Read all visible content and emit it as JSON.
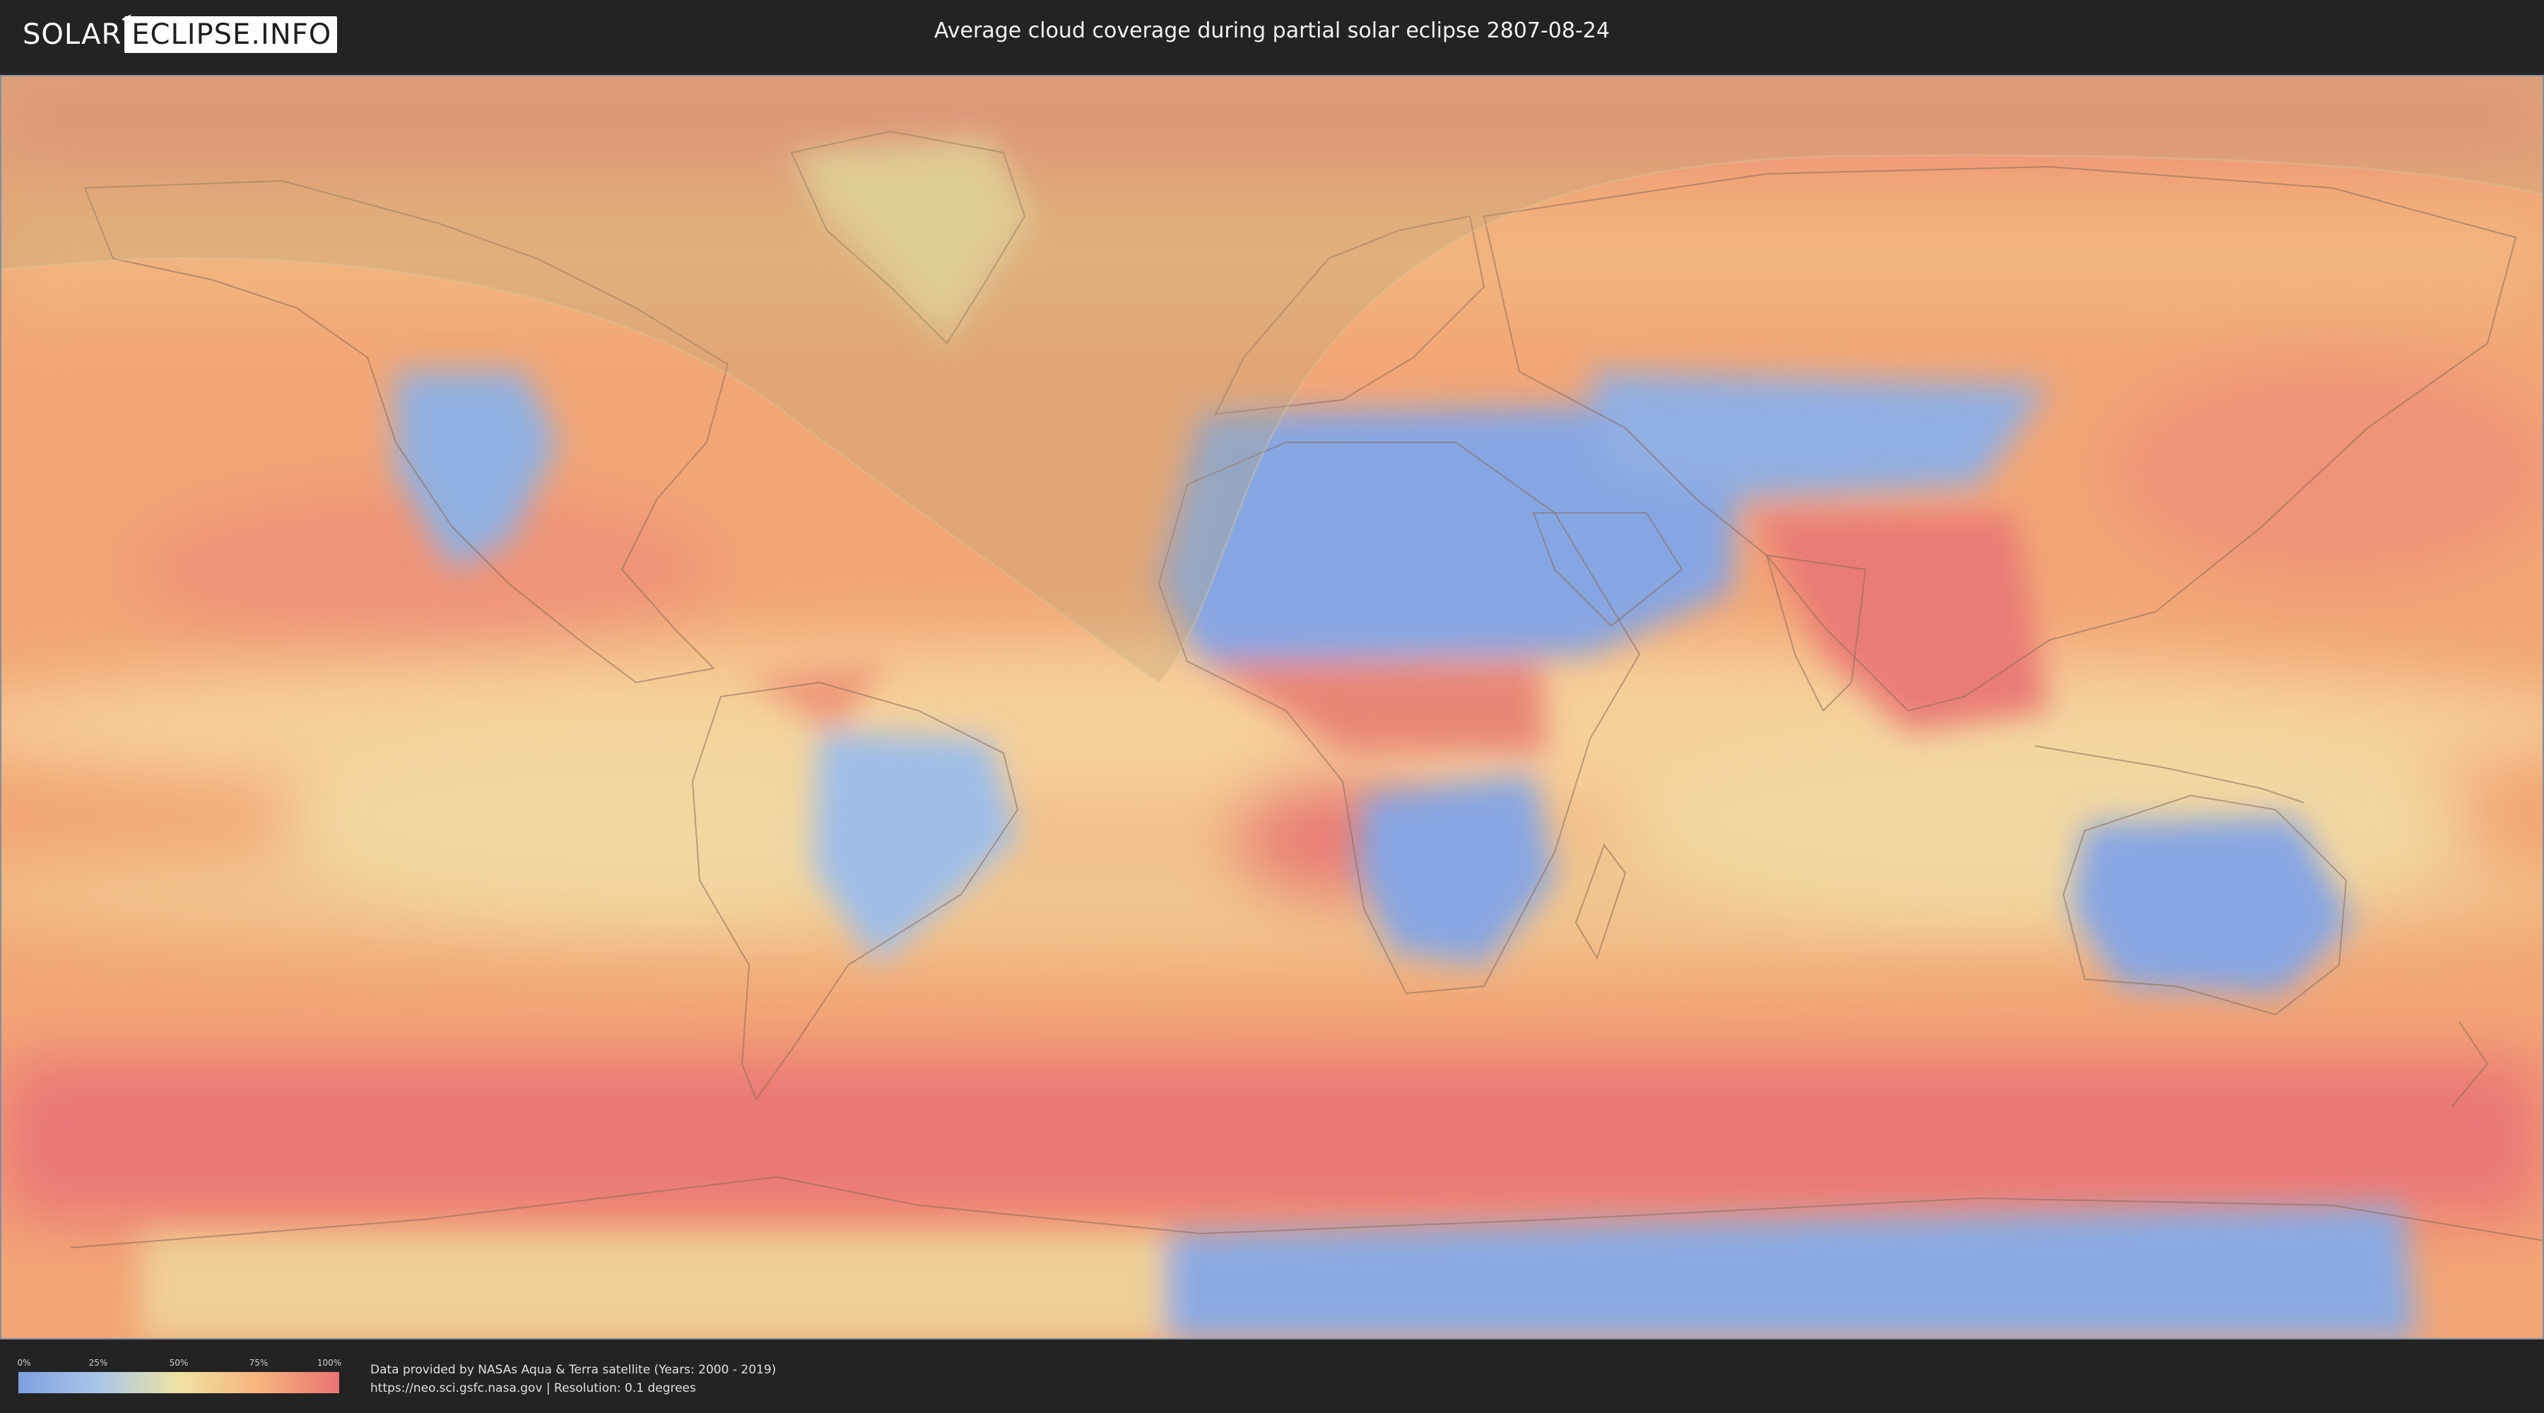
{
  "header": {
    "logo_left": "SOLAR",
    "logo_right": "ECLIPSE.INFO",
    "title": "Average cloud coverage during partial solar eclipse 2807-08-24"
  },
  "map": {
    "colors": {
      "clear": "#7f9fe2",
      "low": "#a9c7e9",
      "mid": "#efe2a2",
      "high": "#f6b47c",
      "overcast": "#ea7373",
      "eclipse_shade": "#b9a57a"
    },
    "layer_names": [
      "cloud-coverage-raster",
      "coastlines",
      "country-borders",
      "eclipse-visibility-zone"
    ]
  },
  "legend": {
    "ticks": [
      "0%",
      "25%",
      "50%",
      "75%",
      "100%"
    ]
  },
  "credits": {
    "line1": "Data provided by NASAs Aqua & Terra satellite (Years: 2000 - 2019)",
    "line2": "https://neo.sci.gsfc.nasa.gov | Resolution: 0.1 degrees"
  }
}
